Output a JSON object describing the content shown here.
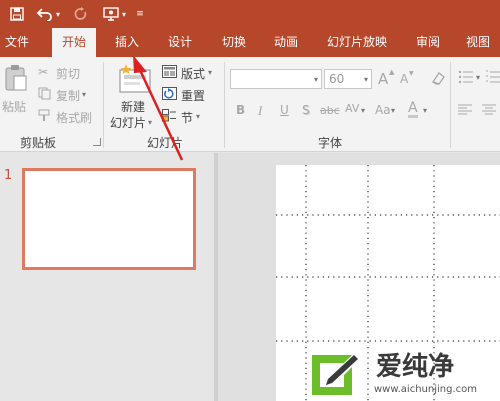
{
  "qat": {
    "save_icon": "save-icon",
    "undo_icon": "undo-icon",
    "redo_icon": "redo-icon",
    "present_icon": "present-from-start-icon",
    "customize_icon": "customize-qat-icon"
  },
  "tabs": [
    {
      "label": "文件",
      "active": false
    },
    {
      "label": "开始",
      "active": true
    },
    {
      "label": "插入",
      "active": false
    },
    {
      "label": "设计",
      "active": false
    },
    {
      "label": "切换",
      "active": false
    },
    {
      "label": "动画",
      "active": false
    },
    {
      "label": "幻灯片放映",
      "active": false
    },
    {
      "label": "审阅",
      "active": false
    },
    {
      "label": "视图",
      "active": false
    }
  ],
  "clipboard": {
    "paste_label": "粘贴",
    "cut_label": "剪切",
    "copy_label": "复制",
    "format_painter_label": "格式刷",
    "group_label": "剪贴板"
  },
  "slides": {
    "new_slide_line1": "新建",
    "new_slide_line2": "幻灯片",
    "layout_label": "版式",
    "reset_label": "重置",
    "section_label": "节",
    "group_label": "幻灯片"
  },
  "font": {
    "font_name": "",
    "font_size": "60",
    "bold": "B",
    "italic": "I",
    "underline": "U",
    "shadow": "S",
    "strikethrough": "abc",
    "spacing": "AV",
    "case": "Aa",
    "color": "A",
    "grow": "A",
    "shrink": "A",
    "group_label": "字体"
  },
  "thumbnails": {
    "slide_number": "1"
  },
  "watermark": {
    "brand": "爱纯净",
    "url": "www.aichunjing.com"
  },
  "colors": {
    "accent": "#b7472a",
    "thumb_border": "#e07a5f",
    "watermark_green": "#6bbd2a"
  }
}
